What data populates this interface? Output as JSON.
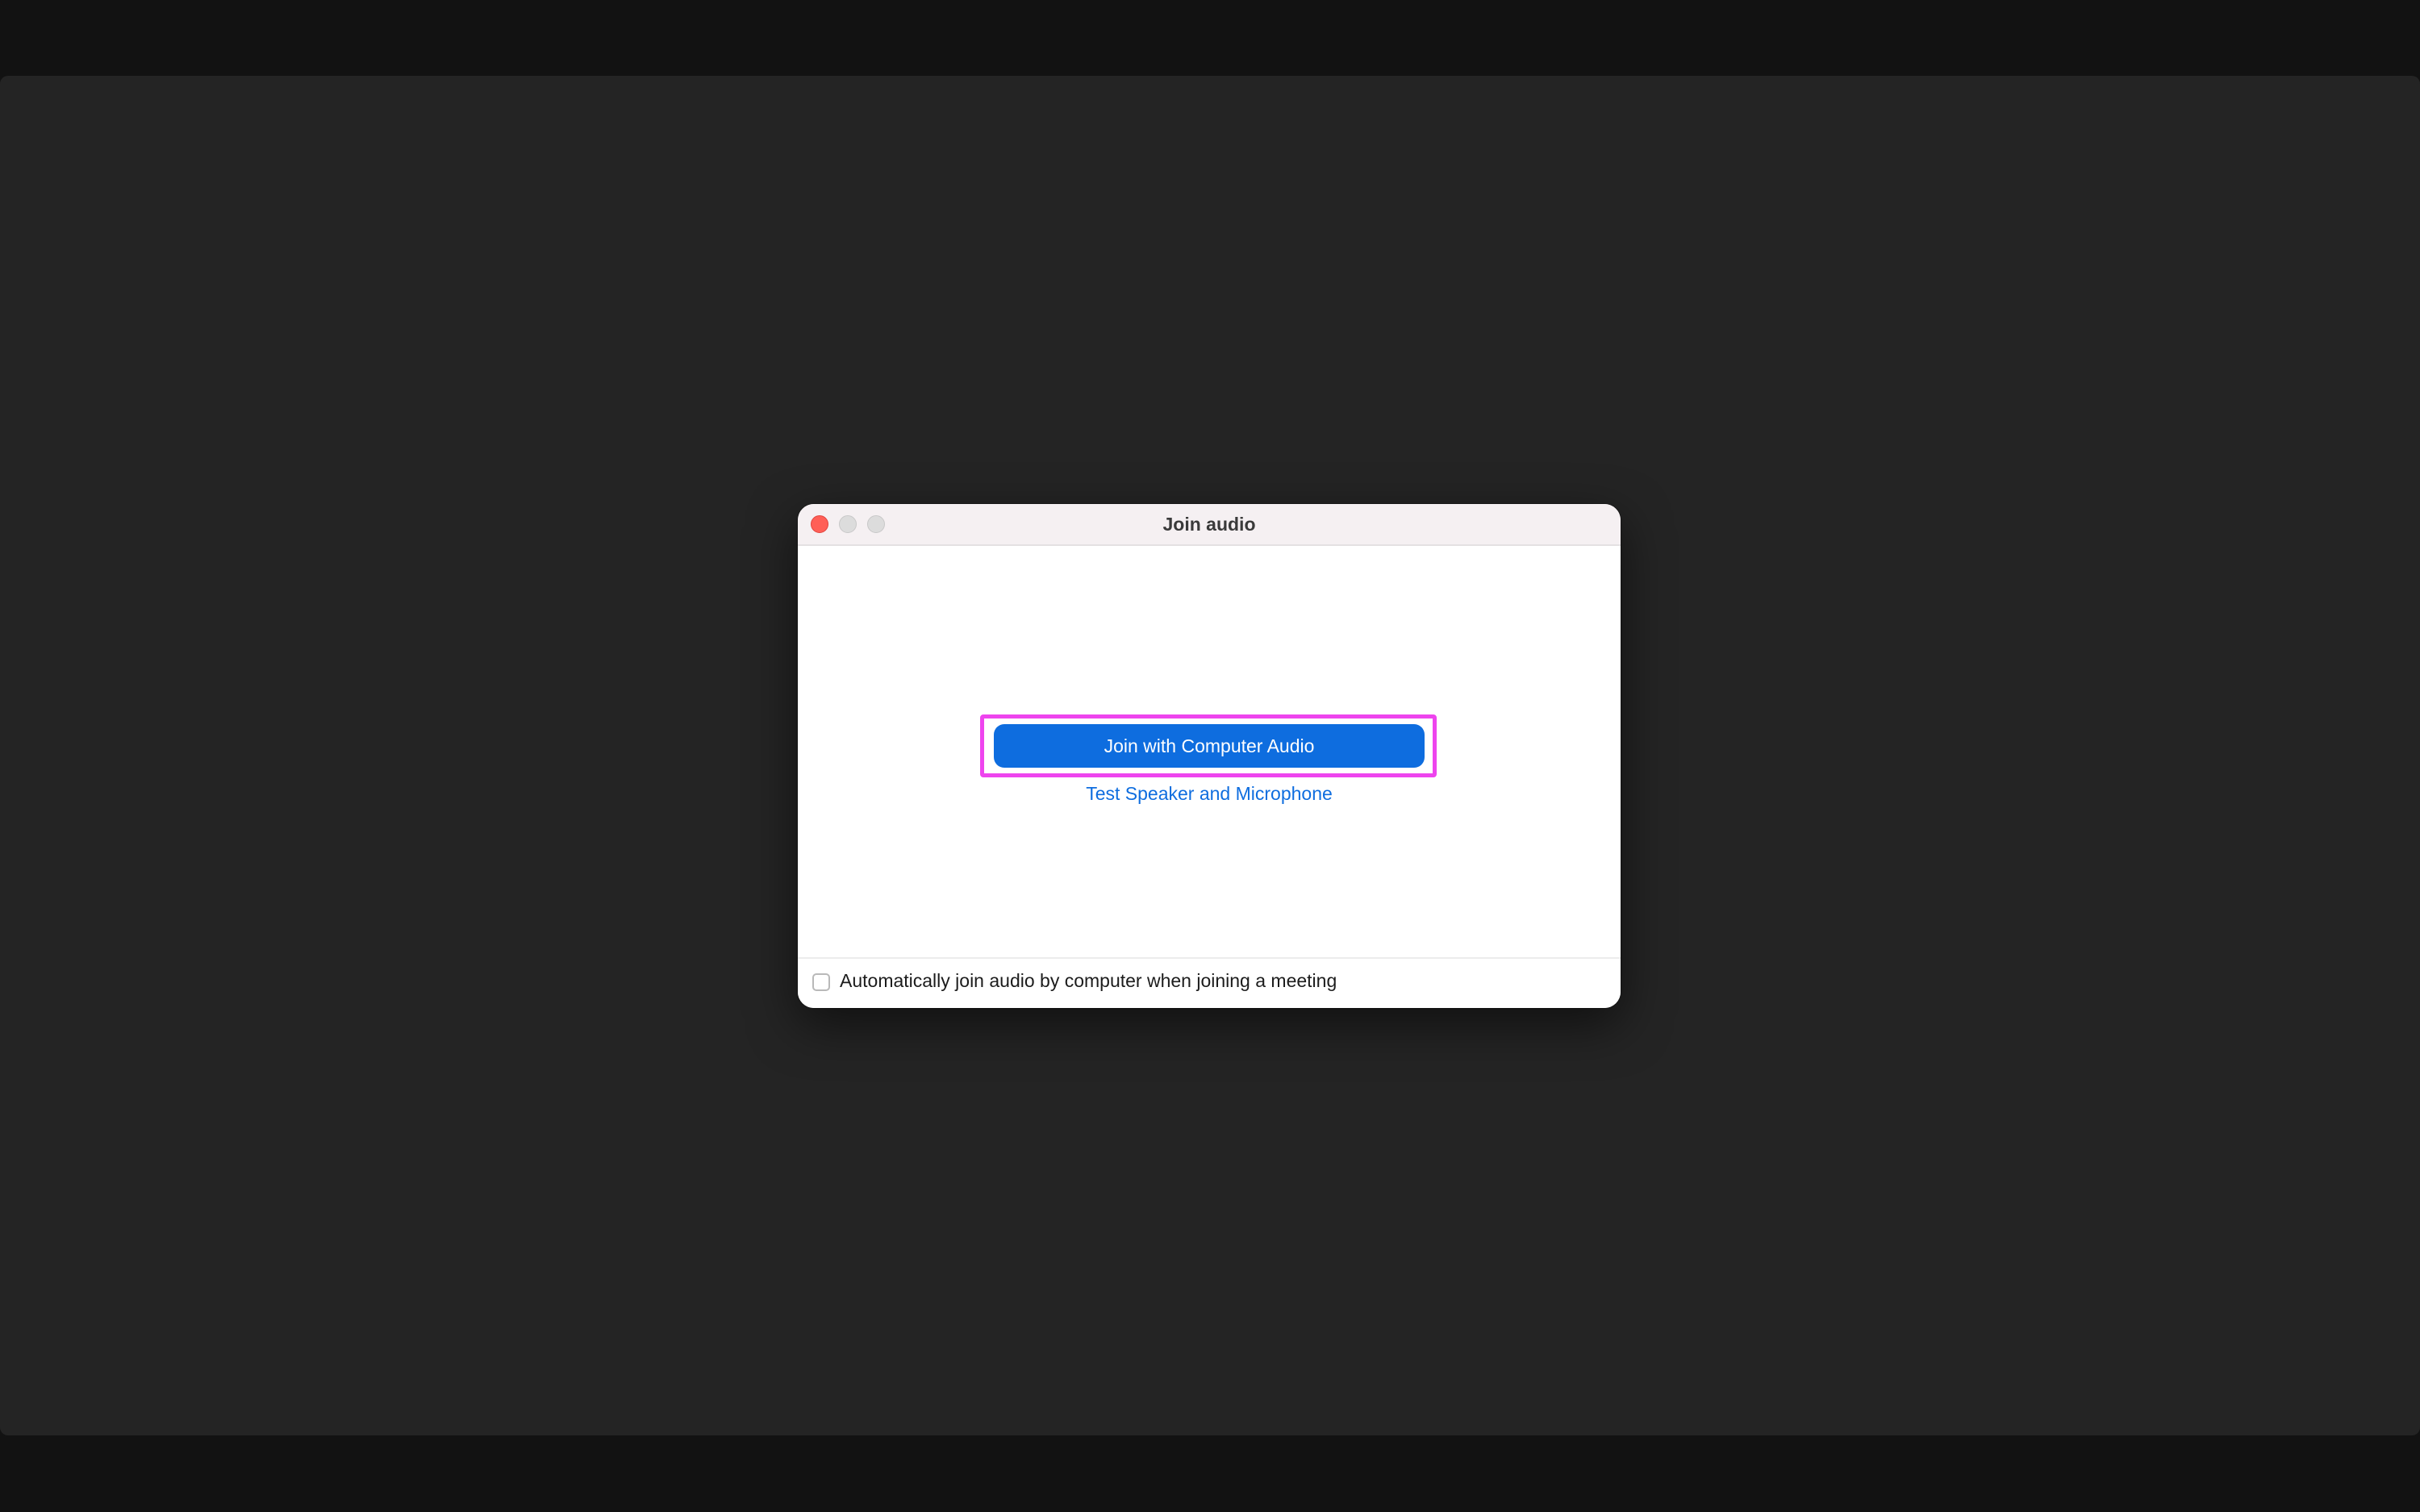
{
  "dialog": {
    "title": "Join audio",
    "primary_button_label": "Join with Computer Audio",
    "test_link_label": "Test Speaker and Microphone",
    "auto_join_checkbox": {
      "label": "Automatically join audio by computer when joining a meeting",
      "checked": false
    }
  },
  "window_controls": {
    "close": "close-icon",
    "minimize": "minimize-icon",
    "zoom": "zoom-icon"
  },
  "colors": {
    "backdrop": "#121212",
    "screen": "#242424",
    "accent": "#0e6ddf",
    "highlight": "#ee44ee",
    "close_button": "#ff5f57"
  }
}
